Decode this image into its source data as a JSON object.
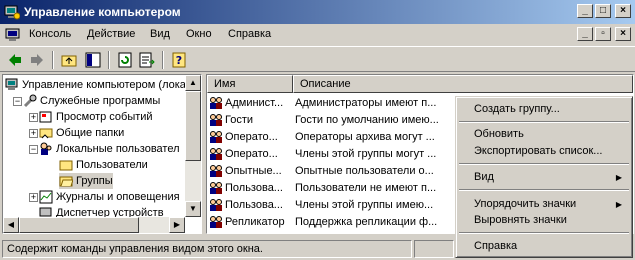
{
  "window": {
    "title": "Управление компьютером"
  },
  "menu": [
    "Консоль",
    "Действие",
    "Вид",
    "Окно",
    "Справка"
  ],
  "tree": [
    {
      "label": "Управление компьютером (лока",
      "level": 0
    },
    {
      "label": "Служебные программы",
      "level": 1
    },
    {
      "label": "Просмотр событий",
      "level": 2
    },
    {
      "label": "Общие папки",
      "level": 2
    },
    {
      "label": "Локальные пользовател",
      "level": 2
    },
    {
      "label": "Пользователи",
      "level": 3
    },
    {
      "label": "Группы",
      "level": 3
    },
    {
      "label": "Журналы и оповещения",
      "level": 2
    },
    {
      "label": "Диспетчер устройств",
      "level": 2
    }
  ],
  "list": {
    "columns": [
      "Имя",
      "Описание"
    ],
    "rows": [
      {
        "name": "Админист...",
        "desc": "Администраторы имеют п..."
      },
      {
        "name": "Гости",
        "desc": "Гости по умолчанию имею..."
      },
      {
        "name": "Операто...",
        "desc": "Операторы архива могут ..."
      },
      {
        "name": "Операто...",
        "desc": "Члены этой группы могут ..."
      },
      {
        "name": "Опытные...",
        "desc": "Опытные пользователи о..."
      },
      {
        "name": "Пользова...",
        "desc": "Пользователи не имеют п..."
      },
      {
        "name": "Пользова...",
        "desc": "Члены этой группы имею..."
      },
      {
        "name": "Репликатор",
        "desc": "Поддержка репликации ф..."
      }
    ]
  },
  "context_menu": {
    "create_group": "Создать группу...",
    "refresh": "Обновить",
    "export": "Экспортировать список...",
    "view": "Вид",
    "arrange_icons": "Упорядочить значки",
    "align_icons": "Выровнять значки",
    "help": "Справка"
  },
  "status": {
    "text": "Содержит команды управления видом этого окна."
  }
}
